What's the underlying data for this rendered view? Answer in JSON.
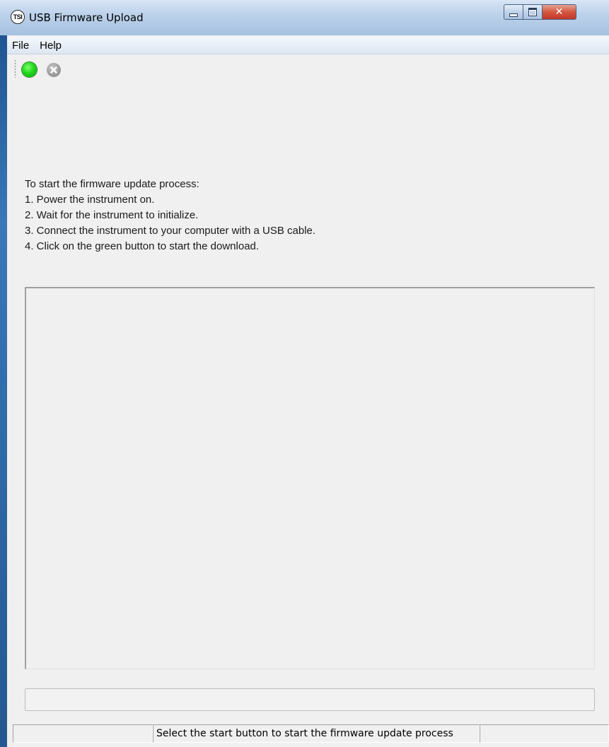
{
  "window": {
    "title": "USB Firmware Upload",
    "app_icon_text": "TSI"
  },
  "menu": {
    "items": [
      "File",
      "Help"
    ]
  },
  "toolbar": {
    "start_icon": "green-circle-start",
    "stop_icon": "gray-x-circle-stop",
    "accent_green": "#22d61f"
  },
  "instructions": {
    "heading": "To start the firmware update process:",
    "steps": [
      "1. Power the instrument on.",
      "2. Wait for the instrument to initialize.",
      "3. Connect the instrument to your computer with a USB cable.",
      "4. Click on the green button to start the download."
    ]
  },
  "log": {
    "content": ""
  },
  "progress": {
    "value": 0
  },
  "status": {
    "panel_left": "",
    "message": "Select the start button to start the firmware update process",
    "panel_right": ""
  }
}
